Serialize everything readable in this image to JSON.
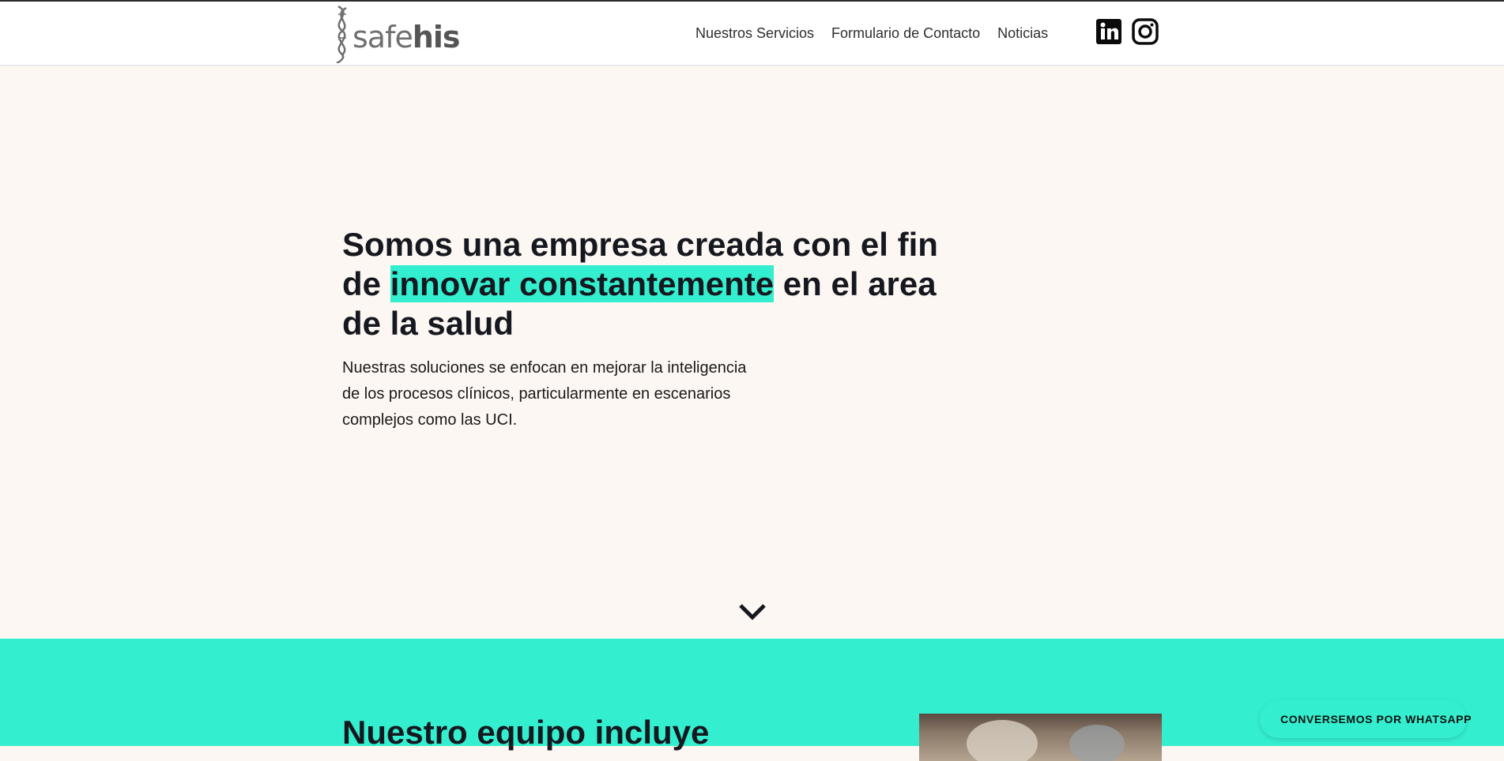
{
  "header": {
    "logo": {
      "text_light": "safe",
      "text_bold": "his"
    },
    "nav": [
      {
        "label": "Nuestros Servicios"
      },
      {
        "label": "Formulario de Contacto"
      },
      {
        "label": "Noticias"
      }
    ],
    "social": [
      {
        "icon": "linkedin-icon"
      },
      {
        "icon": "instagram-icon"
      }
    ]
  },
  "hero": {
    "title_before": "Somos una empresa creada con el fin de ",
    "title_highlight": "innovar constantemente",
    "title_after": " en el area de la salud",
    "text": "Nuestras soluciones se enfocan en mejorar la inteligencia de los procesos clínicos, particularmente en escenarios complejos como las UCI.",
    "scroll_icon": "chevron-down-icon"
  },
  "team": {
    "title": "Nuestro equipo incluye"
  },
  "whatsapp": {
    "label": "CONVERSEMOS POR WHATSAPP",
    "icon": "whatsapp-icon"
  },
  "colors": {
    "accent": "#33efcf",
    "background": "#fcf7f2",
    "text_dark": "#16181f"
  }
}
